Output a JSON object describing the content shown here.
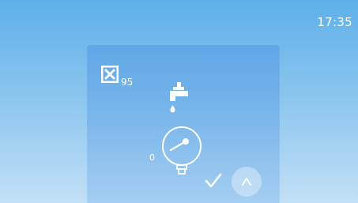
{
  "status_bar": {
    "time": "17:35"
  },
  "panel": {
    "cancel_icon": "close-box-icon",
    "counter_value": "95",
    "tap_icon": "water-tap-drip-icon",
    "gauge_icon": "pressure-gauge-icon",
    "gauge_value": "0",
    "confirm_icon": "checkmark-icon",
    "up_icon": "chevron-up-icon"
  },
  "colors": {
    "icon": "#ffffff",
    "background_top": "#5eb0ea",
    "background_bottom": "#c2e0f6",
    "panel_top": "#5fa8e6"
  }
}
